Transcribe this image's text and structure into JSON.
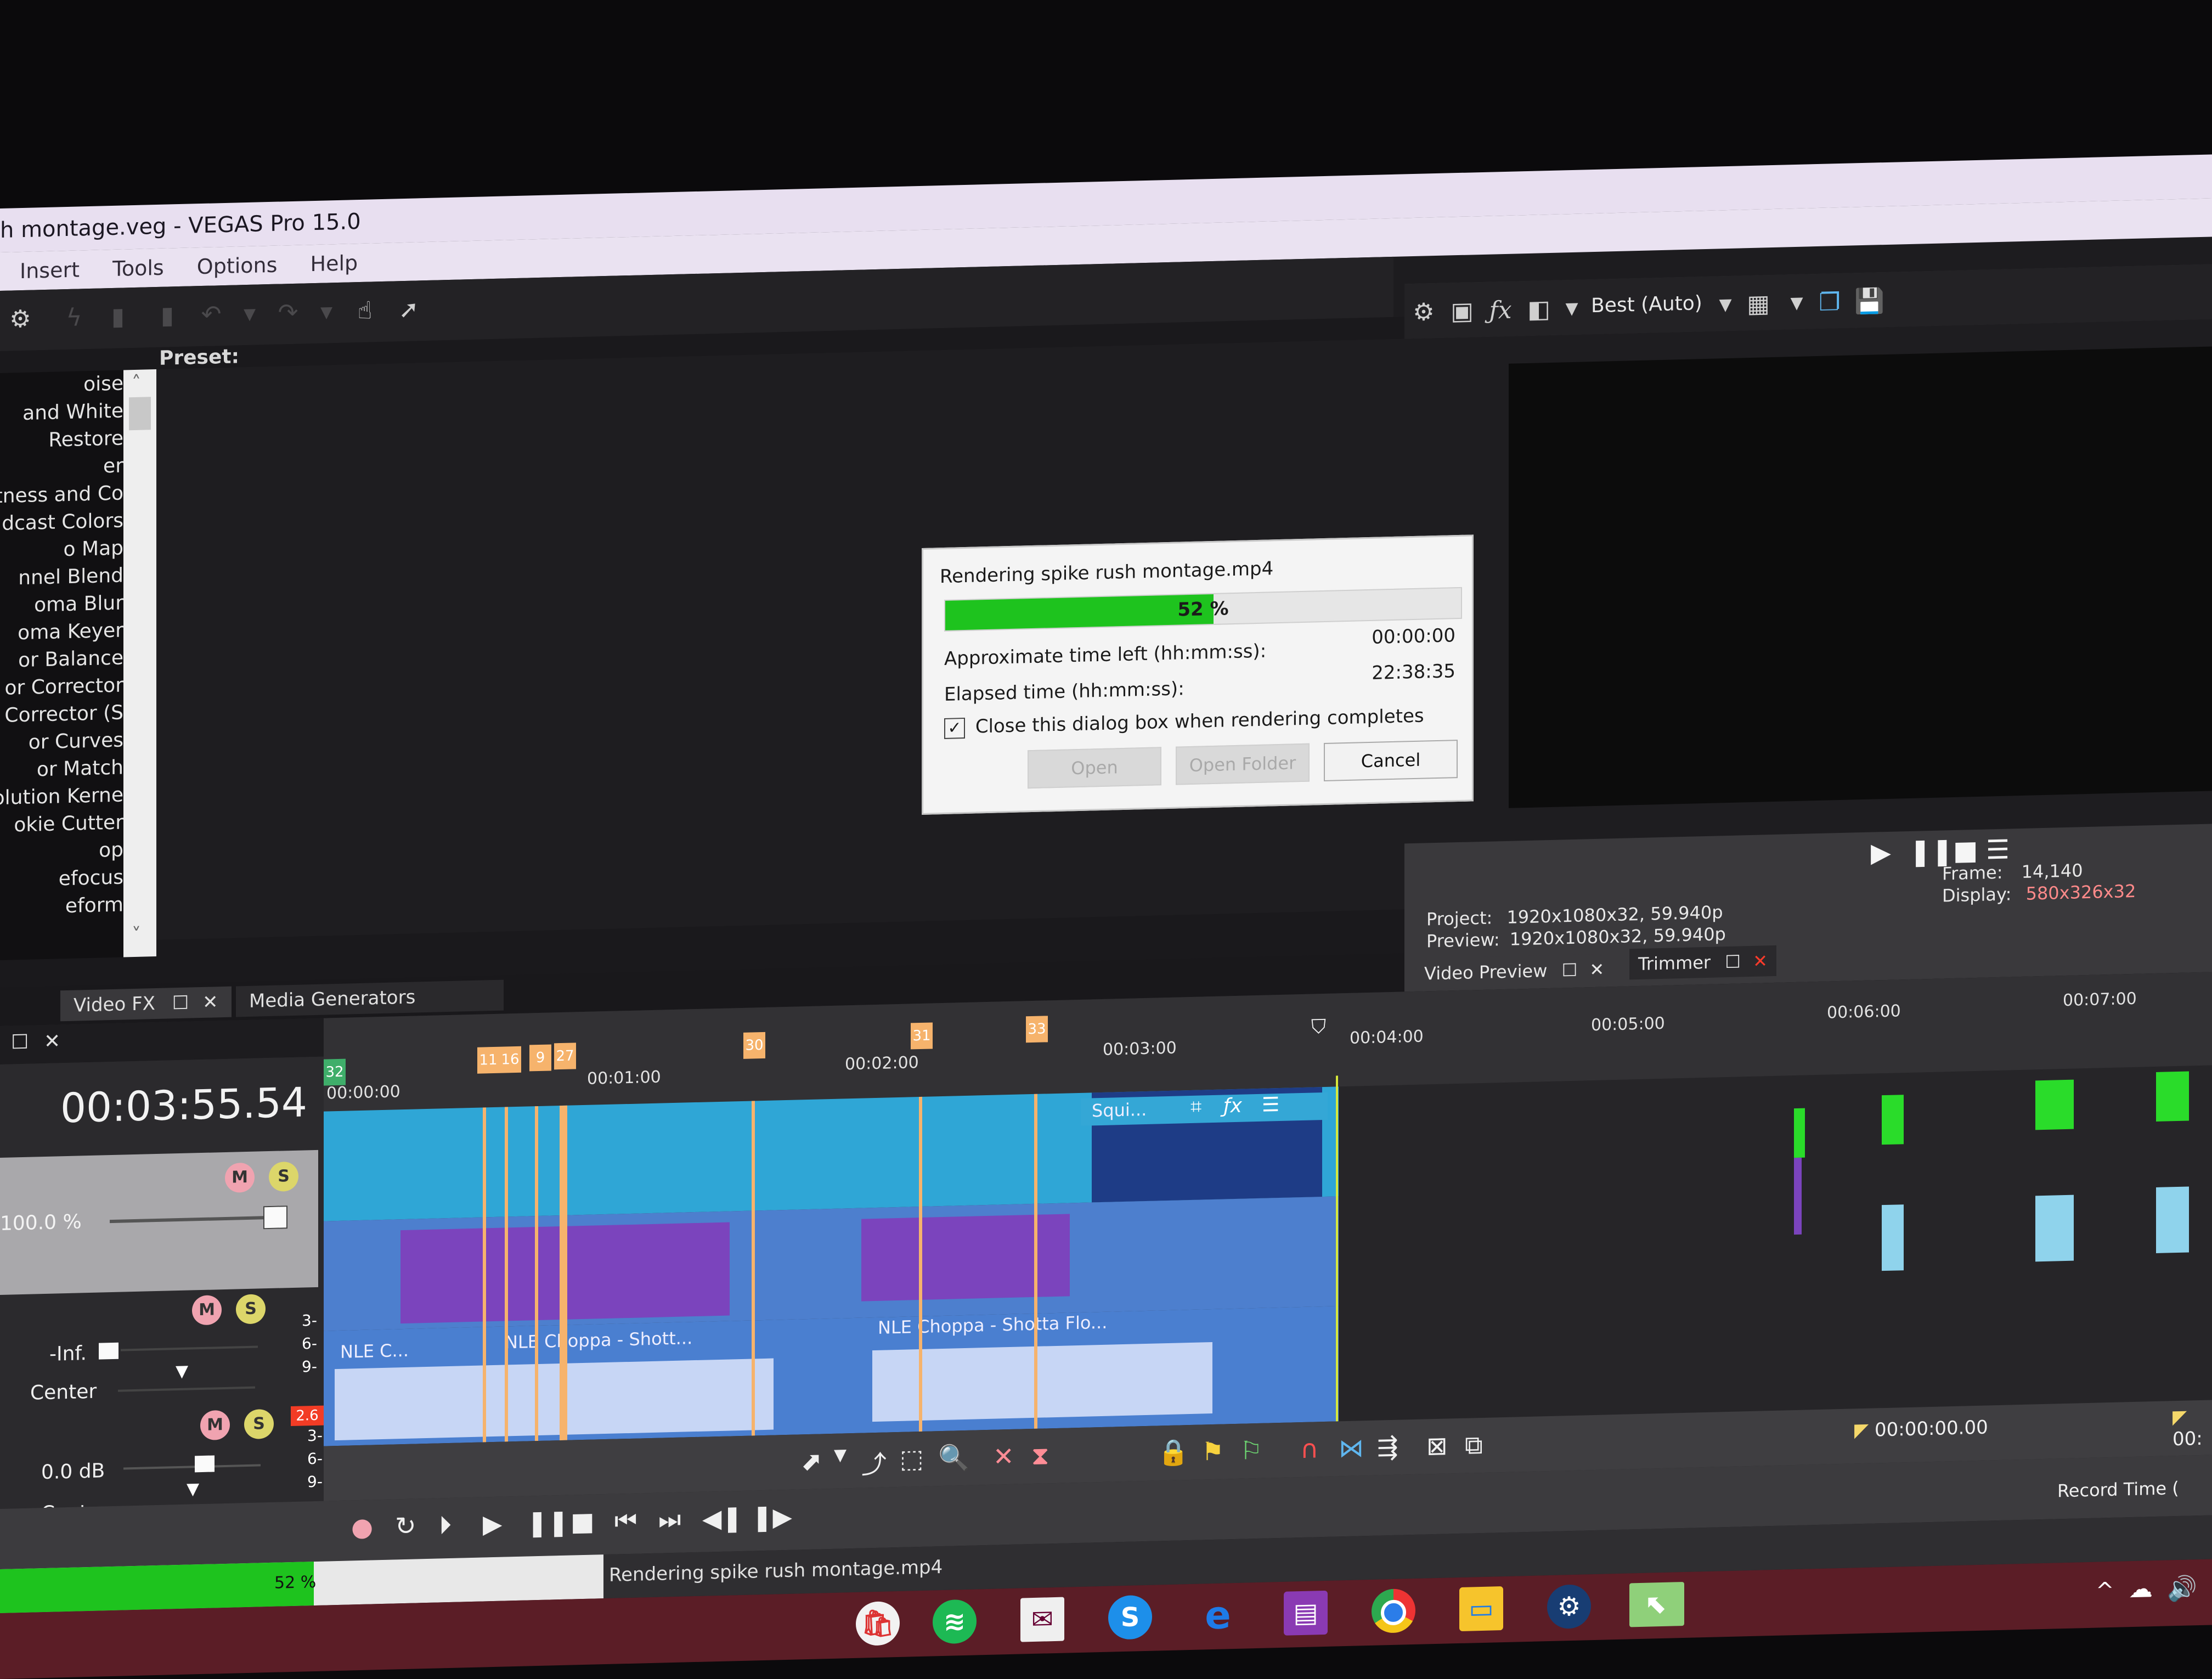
{
  "window": {
    "title": "h montage.veg - VEGAS Pro 15.0"
  },
  "menu": {
    "items": [
      "Insert",
      "Tools",
      "Options",
      "Help"
    ]
  },
  "toolbar": {
    "icons": [
      "gear-icon",
      "lightning-icon",
      "copy-icon",
      "paste-icon",
      "undo-icon",
      "undo-dropdown-icon",
      "redo-icon",
      "redo-dropdown-icon",
      "whats-this-hand-icon",
      "help-pointer-icon"
    ]
  },
  "fx_panel": {
    "preset_label": "Preset:",
    "items": [
      "oise",
      "and White",
      "Restore",
      "er",
      "tness and Co",
      "dcast Colors",
      "o Map",
      "nnel Blend",
      "oma Blur",
      "oma Keyer",
      "or Balance",
      "or Corrector",
      "or Corrector (S",
      "or Curves",
      "or Match",
      "nvolution Kerne",
      "okie Cutter",
      "op",
      "efocus",
      "eform"
    ],
    "tabs": [
      {
        "label": "Video FX",
        "active": true
      },
      {
        "label": "Media Generators",
        "active": false
      }
    ]
  },
  "preview": {
    "quality": "Best (Auto)",
    "project_label": "Project:",
    "project_value": "1920x1080x32, 59.940p",
    "preview_label": "Preview:",
    "preview_value": "1920x1080x32, 59.940p",
    "frame_label": "Frame:",
    "frame_value": "14,140",
    "display_label": "Display:",
    "display_value": "580x326x32",
    "tabs": [
      {
        "label": "Video Preview",
        "active": true
      },
      {
        "label": "Trimmer",
        "active": false
      }
    ]
  },
  "render_dialog": {
    "title": "Rendering spike rush montage.mp4",
    "progress_percent": 52,
    "progress_label": "52 %",
    "time_left_label": "Approximate time left (hh:mm:ss):",
    "time_left_value": "00:00:00",
    "elapsed_label": "Elapsed time (hh:mm:ss):",
    "elapsed_value": "22:38:35",
    "close_checkbox_label": "Close this dialog box when rendering completes",
    "close_checkbox_checked": true,
    "buttons": {
      "open": "Open",
      "open_folder": "Open Folder",
      "cancel": "Cancel"
    }
  },
  "timeline": {
    "timecode": "00:03:55.54",
    "video_track": {
      "level": "100.0 %"
    },
    "audio_track_1": {
      "volume": "-Inf.",
      "pan": "Center",
      "meter_ticks": [
        "3-",
        "6-",
        "9-"
      ]
    },
    "audio_track_2": {
      "volume": "0.0 dB",
      "pan": "Center",
      "peak": "2.6",
      "meter_ticks": [
        "3-",
        "6-",
        "9-"
      ]
    },
    "ruler_ticks": [
      "00:00:00",
      "00:01:00",
      "00:02:00",
      "00:03:00",
      "00:04:00",
      "00:05:00",
      "00:06:00",
      "00:07:00"
    ],
    "markers": [
      "32",
      "11",
      "16",
      "9",
      "27",
      "30",
      "31",
      "33"
    ],
    "clips": {
      "video_end_clip": "Squi...",
      "audio_clip_1": "NLE C...",
      "audio_clip_2": "NLE Choppa - Shott...",
      "audio_clip_3": "NLE Choppa - Shotta Flo..."
    },
    "selection_start": "00:00:00.00",
    "selection_end_partial": "00:",
    "record_time_label": "Record Time ("
  },
  "status": {
    "render_status": "Rendering spike rush montage.mp4",
    "progress_partial": "52 %"
  },
  "taskbar": {
    "apps": [
      "store",
      "spotify",
      "mail",
      "skype",
      "edge",
      "winrar",
      "chrome",
      "file-explorer",
      "steam",
      "vegas-pro"
    ]
  },
  "colors": {
    "progress_green": "#1ec31e",
    "marker_orange": "#f6b36c",
    "video_track_blue": "#2fa6d6",
    "audio_track_blue": "#4d7fce",
    "display_value_red": "#ff8a8a",
    "taskbar_maroon": "#5b1d26"
  }
}
